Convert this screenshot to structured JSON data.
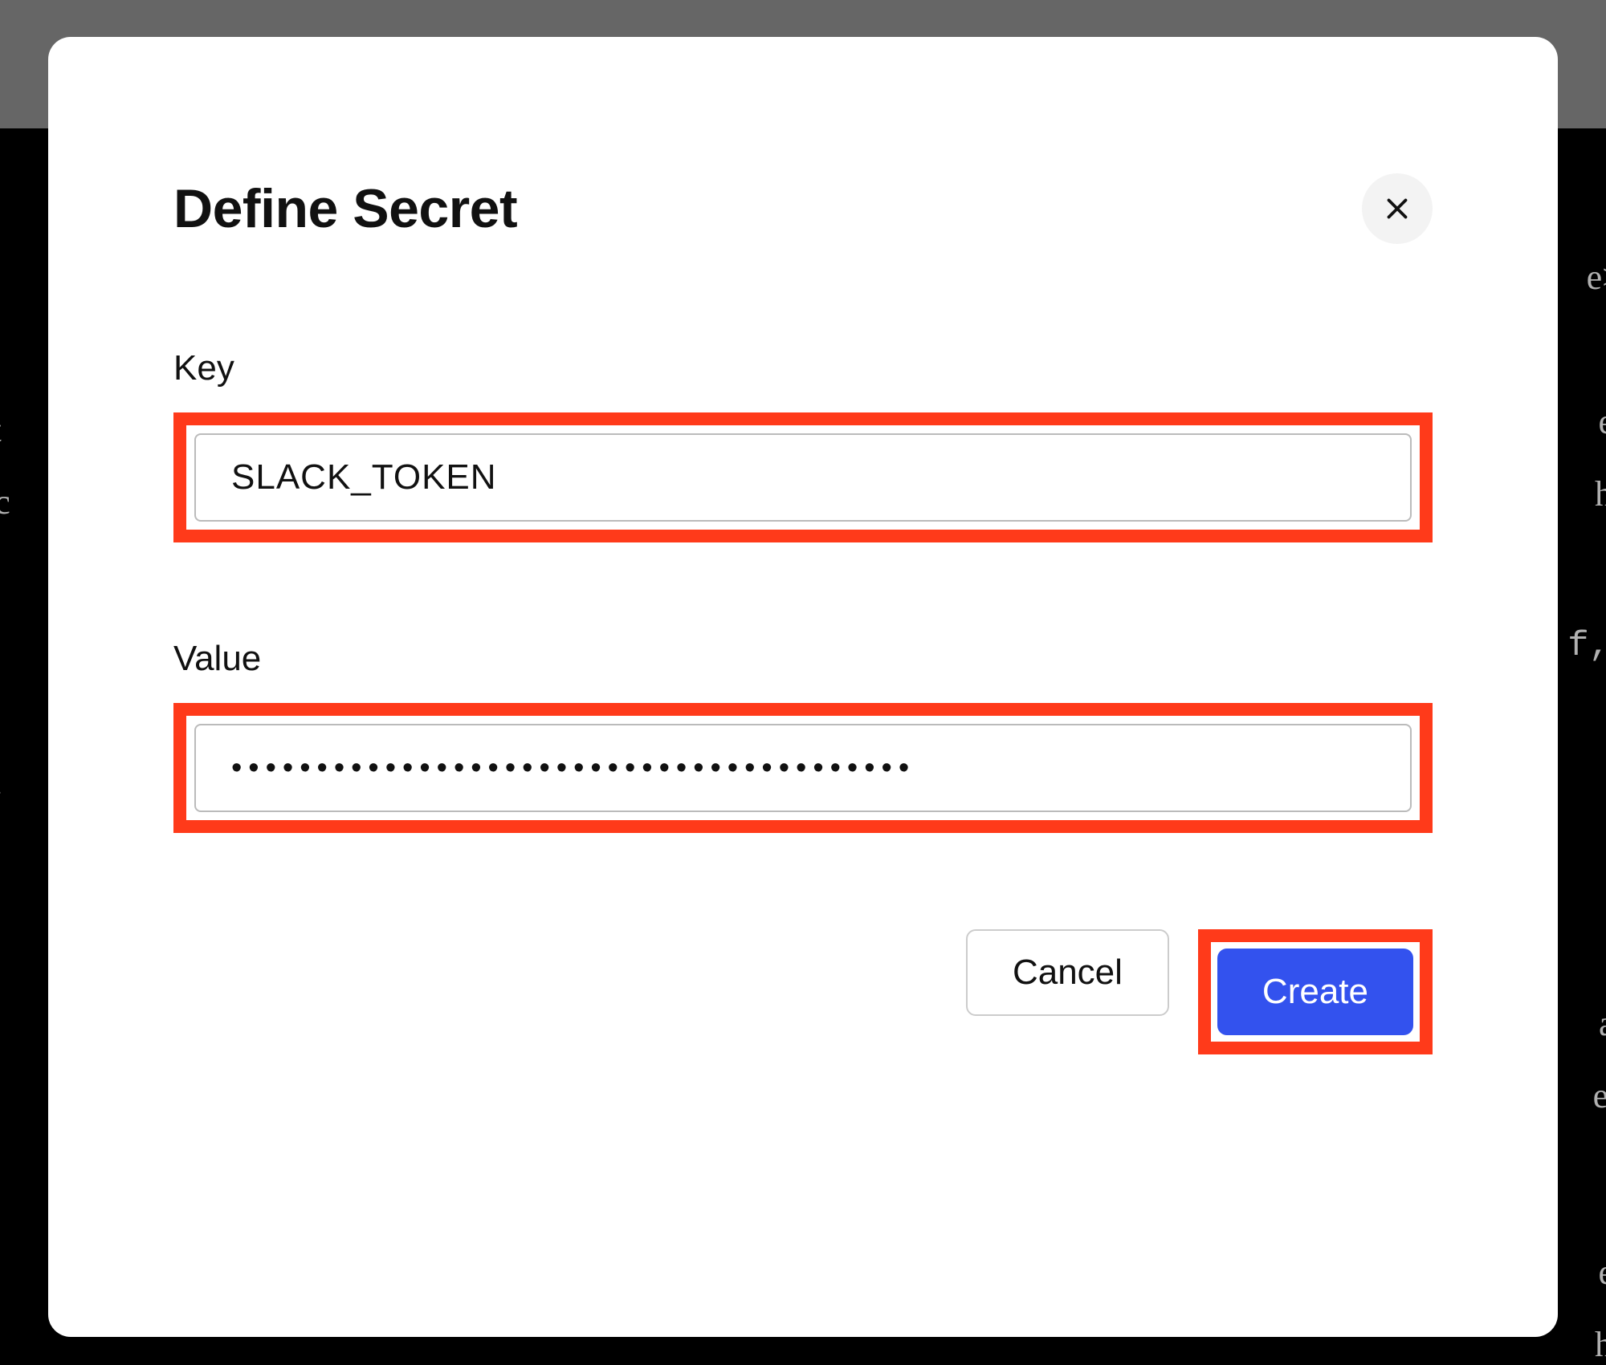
{
  "modal": {
    "title": "Define Secret",
    "close_icon": "close-icon",
    "fields": {
      "key": {
        "label": "Key",
        "value": "SLACK_TOKEN"
      },
      "value": {
        "label": "Value",
        "value": "••••••••••••••••••••••••••••••••••••••••"
      }
    },
    "actions": {
      "cancel": "Cancel",
      "create": "Create"
    }
  },
  "backdrop": {
    "text_fragments": [
      "e>",
      "et",
      "t c",
      "t.",
      "ho",
      "ho",
      "e",
      "ac",
      "ert",
      ",",
      "f,"
    ]
  }
}
